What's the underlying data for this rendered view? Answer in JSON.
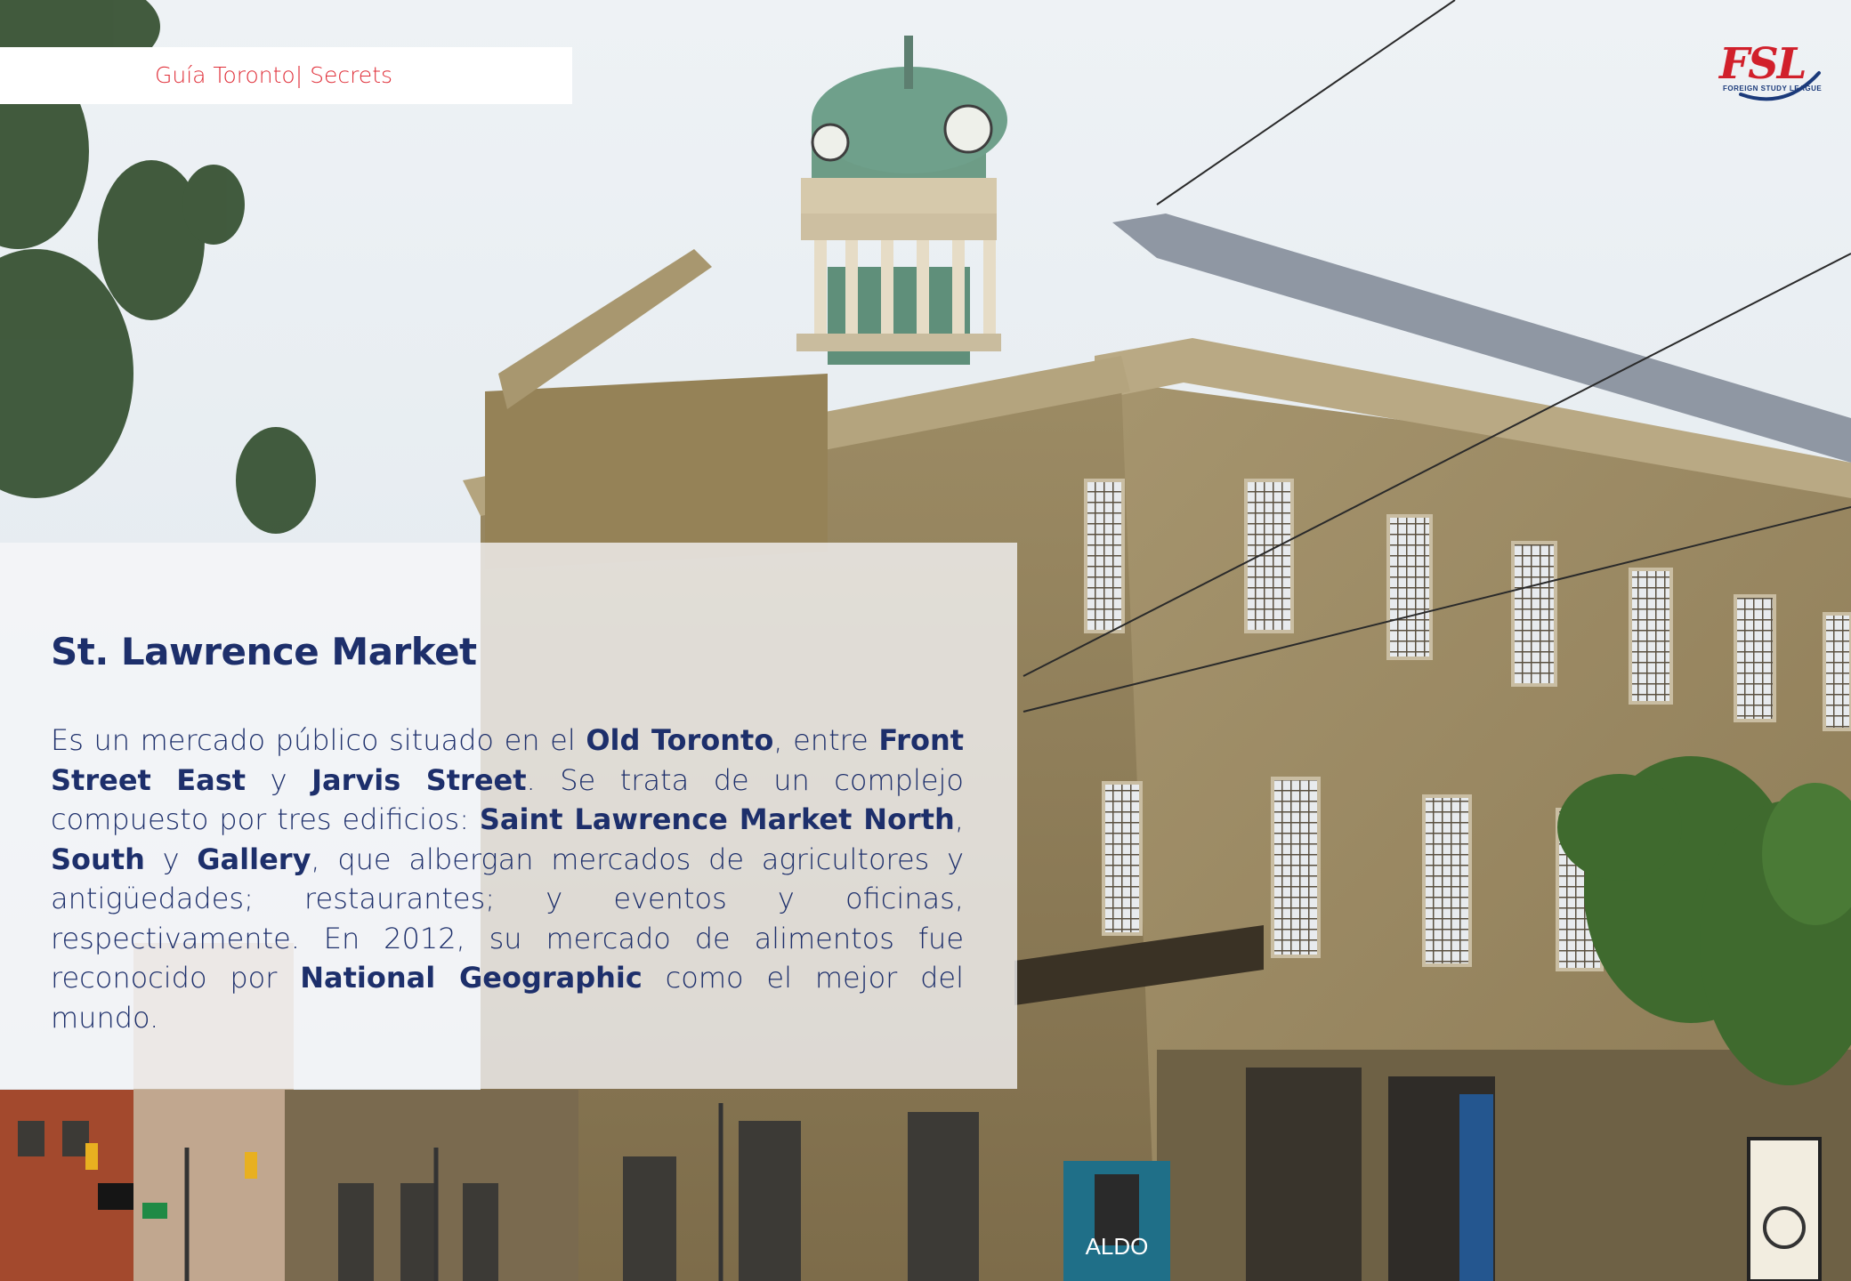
{
  "header": {
    "title": "Guía Toronto| Secrets"
  },
  "logo": {
    "text": "FSL",
    "subtitle": "FOREIGN STUDY LEAGUE"
  },
  "article": {
    "title": "St. Lawrence Market",
    "paragraph": [
      {
        "text": "Es un mercado público situado en el ",
        "bold": false
      },
      {
        "text": "Old Toronto",
        "bold": true
      },
      {
        "text": ", entre ",
        "bold": false
      },
      {
        "text": "Front Street East",
        "bold": true
      },
      {
        "text": " y ",
        "bold": false
      },
      {
        "text": "Jarvis Street",
        "bold": true
      },
      {
        "text": ". Se trata de un complejo compuesto por tres edificios: ",
        "bold": false
      },
      {
        "text": "Saint Lawrence Market North",
        "bold": true
      },
      {
        "text": ", ",
        "bold": false
      },
      {
        "text": "South",
        "bold": true
      },
      {
        "text": " y ",
        "bold": false
      },
      {
        "text": "Gallery",
        "bold": true
      },
      {
        "text": ", que albergan mercados de agricultores y antigüedades; restaurantes; y eventos y oficinas, respectivamente. En 2012, su mercado de alimentos fue reconocido por ",
        "bold": false
      },
      {
        "text": "National Geographic",
        "bold": true
      },
      {
        "text": " como el mejor del mundo.",
        "bold": false
      }
    ]
  },
  "photo": {
    "signage": "ALDO"
  },
  "colors": {
    "header_text": "#e0303a",
    "panel_text": "#1d2f6b",
    "logo_red": "#d1202b",
    "logo_blue": "#1b3a7a"
  }
}
